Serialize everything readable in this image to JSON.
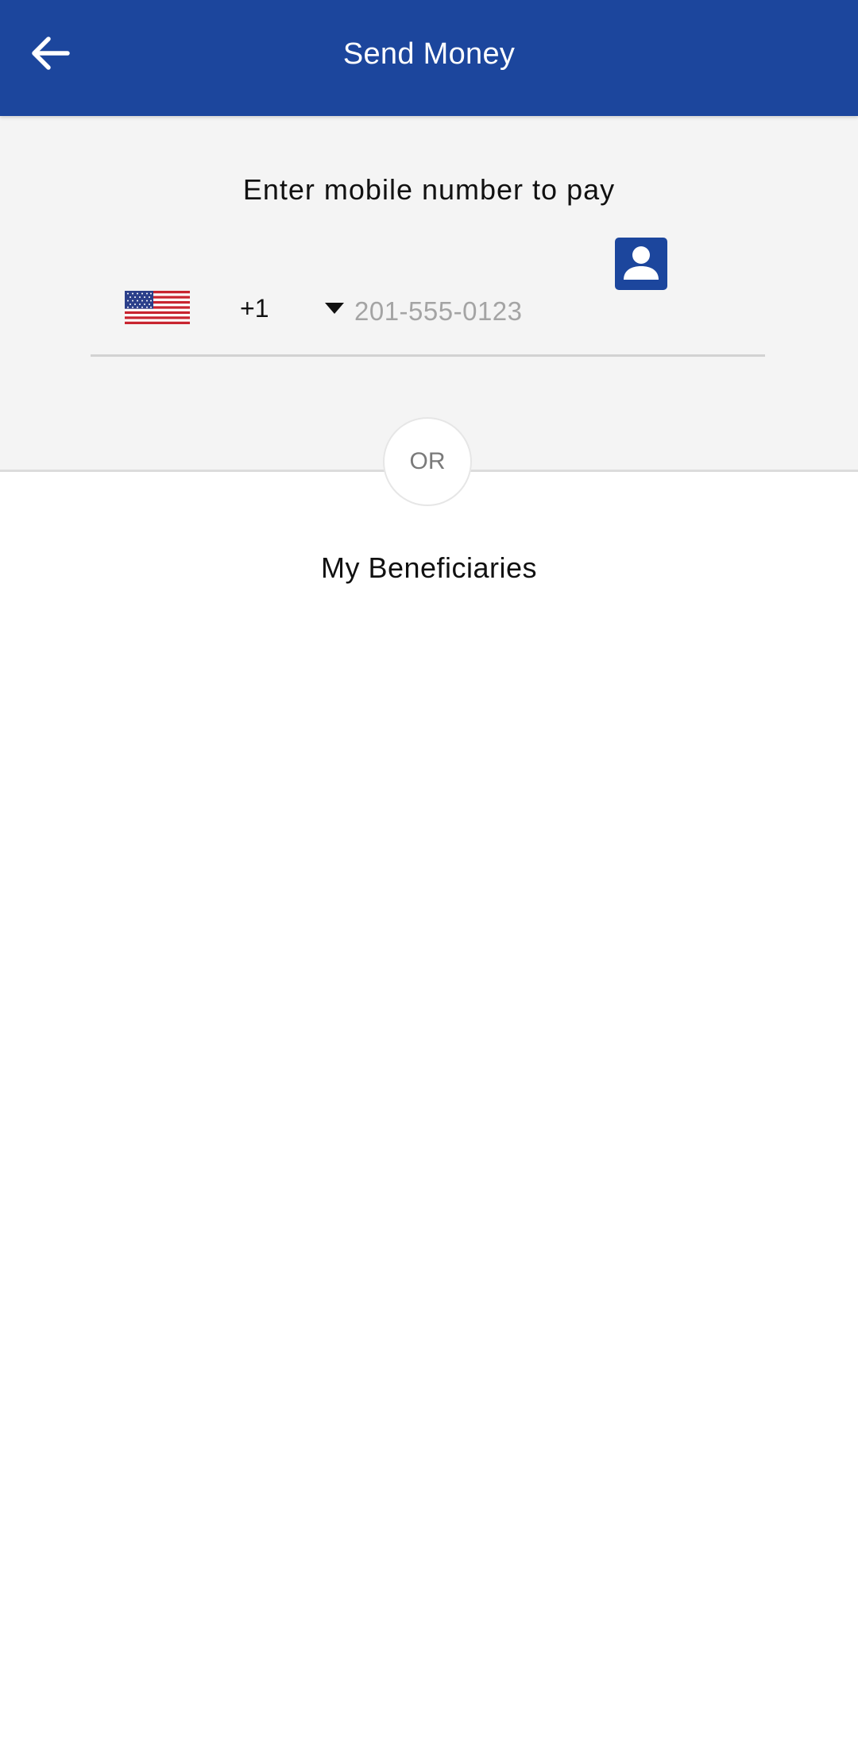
{
  "app_bar": {
    "title": "Send Money",
    "back_icon": "arrow-left-icon",
    "background_color": "#1c469d"
  },
  "phone_entry": {
    "prompt": "Enter mobile number to pay",
    "country": {
      "flag_icon": "us-flag-icon",
      "dial_code": "+1",
      "dropdown_icon": "caret-down-icon"
    },
    "input": {
      "value": "",
      "placeholder": "201-555-0123"
    },
    "contacts_icon": "contact-book-icon"
  },
  "divider": {
    "label": "OR"
  },
  "beneficiaries": {
    "title": "My Beneficiaries",
    "items": []
  }
}
